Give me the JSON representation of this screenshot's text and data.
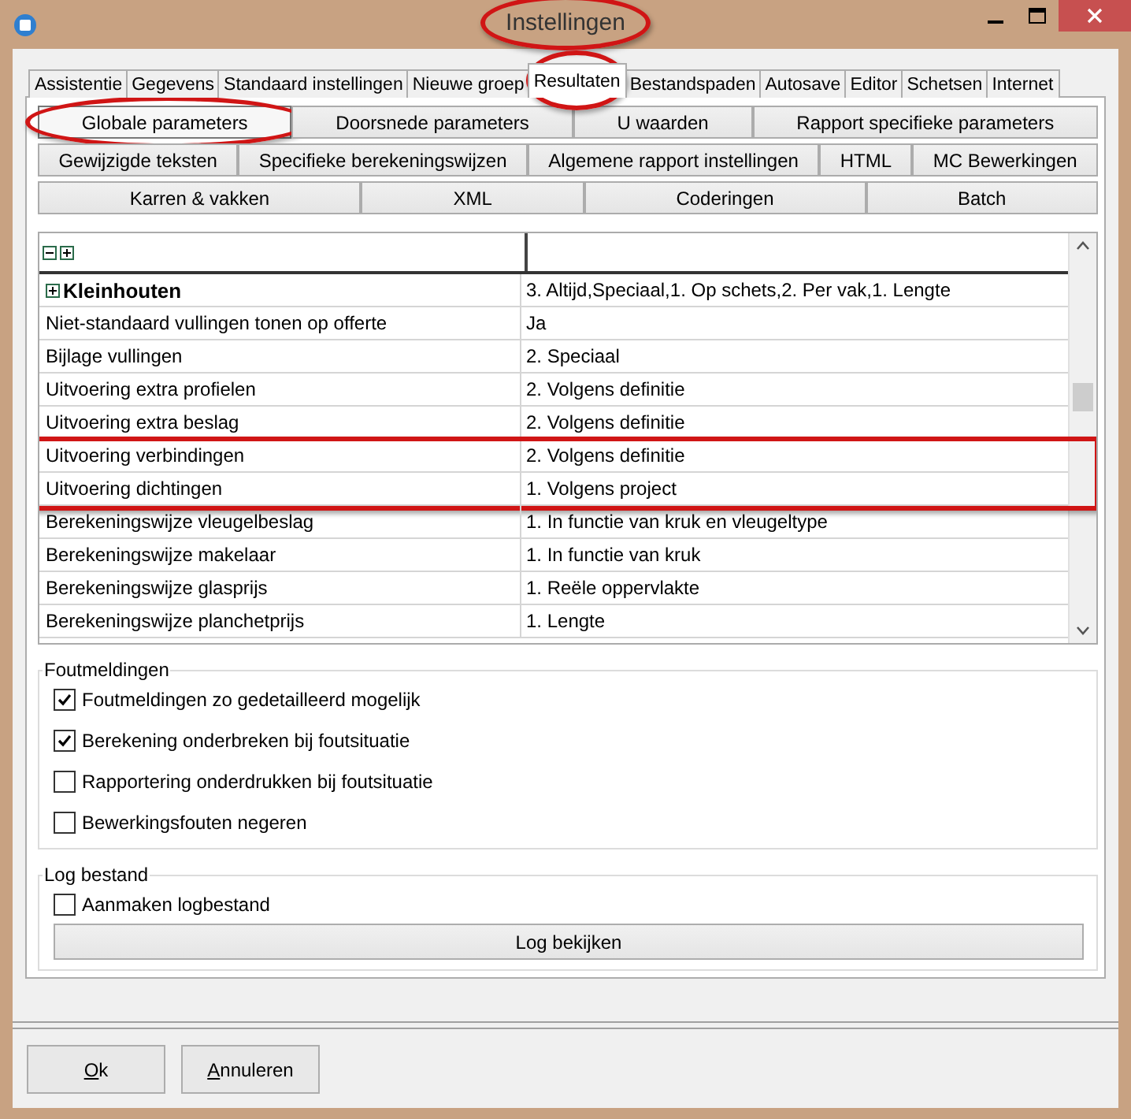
{
  "window": {
    "title": "Instellingen",
    "title_annotated": true
  },
  "tabs": [
    {
      "label": "Assistentie",
      "selected": false,
      "annotated": false
    },
    {
      "label": "Gegevens",
      "selected": false,
      "annotated": false
    },
    {
      "label": "Standaard instellingen",
      "selected": false,
      "annotated": false
    },
    {
      "label": "Nieuwe groep",
      "selected": false,
      "annotated": false
    },
    {
      "label": "Resultaten",
      "selected": true,
      "annotated": true
    },
    {
      "label": "Bestandspaden",
      "selected": false,
      "annotated": false
    },
    {
      "label": "Autosave",
      "selected": false,
      "annotated": false
    },
    {
      "label": "Editor",
      "selected": false,
      "annotated": false
    },
    {
      "label": "Schetsen",
      "selected": false,
      "annotated": false
    },
    {
      "label": "Internet",
      "selected": false,
      "annotated": false
    }
  ],
  "sub_buttons": [
    [
      {
        "label": "Globale parameters",
        "selected": true,
        "annotated": true
      },
      {
        "label": "Doorsnede parameters",
        "selected": false,
        "annotated": false
      },
      {
        "label": "U waarden",
        "selected": false,
        "annotated": false
      },
      {
        "label": "Rapport specifieke parameters",
        "selected": false,
        "annotated": false
      }
    ],
    [
      {
        "label": "Gewijzigde teksten",
        "selected": false,
        "annotated": false
      },
      {
        "label": "Specifieke berekeningswijzen",
        "selected": false,
        "annotated": false
      },
      {
        "label": "Algemene rapport instellingen",
        "selected": false,
        "annotated": false
      },
      {
        "label": "HTML",
        "selected": false,
        "annotated": false
      },
      {
        "label": "MC Bewerkingen",
        "selected": false,
        "annotated": false
      }
    ],
    [
      {
        "label": "Karren & vakken",
        "selected": false,
        "annotated": false
      },
      {
        "label": "XML",
        "selected": false,
        "annotated": false
      },
      {
        "label": "Coderingen",
        "selected": false,
        "annotated": false
      },
      {
        "label": "Batch",
        "selected": false,
        "annotated": false
      }
    ]
  ],
  "grid": {
    "rows": [
      {
        "kind": "group",
        "name": "Kleinhouten",
        "value": "3. Altijd,Speciaal,1. Op schets,2. Per vak,1. Lengte",
        "annotated": false
      },
      {
        "kind": "item",
        "name": "Niet-standaard vullingen tonen op offerte",
        "value": "Ja",
        "annotated": false
      },
      {
        "kind": "item",
        "name": "Bijlage vullingen",
        "value": "2. Speciaal",
        "annotated": false
      },
      {
        "kind": "item",
        "name": "Uitvoering extra profielen",
        "value": "2. Volgens definitie",
        "annotated": false
      },
      {
        "kind": "item",
        "name": "Uitvoering extra beslag",
        "value": "2. Volgens definitie",
        "annotated": false
      },
      {
        "kind": "item",
        "name": "Uitvoering verbindingen",
        "value": "2. Volgens definitie",
        "annotated": true
      },
      {
        "kind": "item",
        "name": "Uitvoering dichtingen",
        "value": "1. Volgens project",
        "annotated": true
      },
      {
        "kind": "item",
        "name": "Berekeningswijze vleugelbeslag",
        "value": "1. In functie van kruk en vleugeltype",
        "annotated": false
      },
      {
        "kind": "item",
        "name": "Berekeningswijze makelaar",
        "value": "1. In functie van kruk",
        "annotated": false
      },
      {
        "kind": "item",
        "name": "Berekeningswijze glasprijs",
        "value": "1. Reële oppervlakte",
        "annotated": false
      },
      {
        "kind": "item",
        "name": "Berekeningswijze planchetprijs",
        "value": "1. Lengte",
        "annotated": false
      }
    ]
  },
  "foutmeldingen": {
    "title": "Foutmeldingen",
    "options": [
      {
        "label": "Foutmeldingen zo gedetailleerd mogelijk",
        "checked": true
      },
      {
        "label": "Berekening onderbreken bij foutsituatie",
        "checked": true
      },
      {
        "label": "Rapportering onderdrukken bij foutsituatie",
        "checked": false
      },
      {
        "label": "Bewerkingsfouten negeren",
        "checked": false
      }
    ]
  },
  "log": {
    "title": "Log bestand",
    "options": [
      {
        "label": "Aanmaken logbestand",
        "checked": false
      }
    ],
    "button": "Log bekijken"
  },
  "buttons": [
    {
      "label": "Ok"
    },
    {
      "label": "Annuleren"
    }
  ]
}
